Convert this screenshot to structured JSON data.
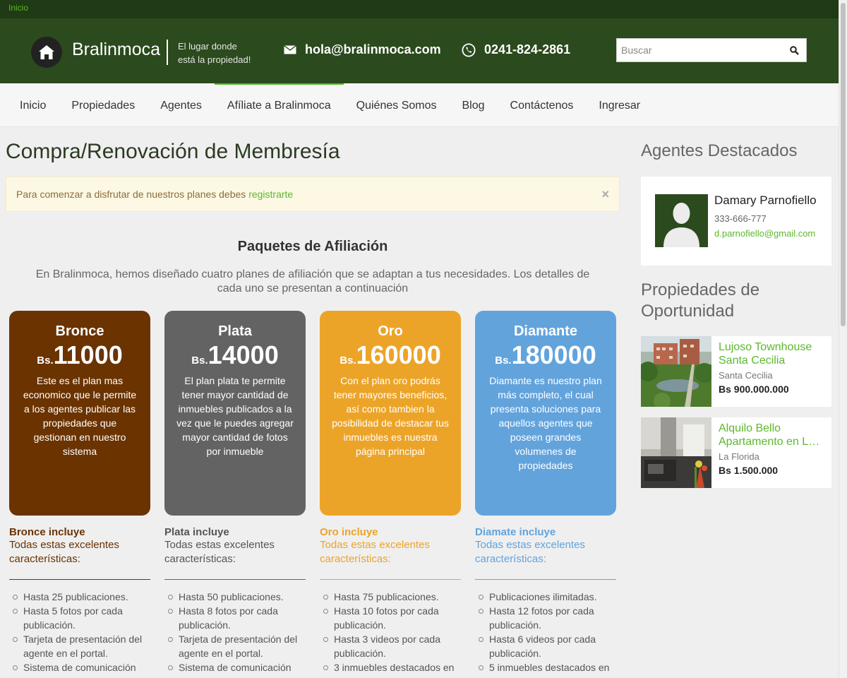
{
  "topbar": {
    "breadcrumb": "Inicio"
  },
  "header": {
    "brand": "Bralinmoca",
    "tagline_line1": "El lugar donde",
    "tagline_line2": "está la propiedad!",
    "email": "hola@bralinmoca.com",
    "phone": "0241-824-2861",
    "search_placeholder": "Buscar"
  },
  "nav": {
    "items": [
      "Inicio",
      "Propiedades",
      "Agentes",
      "Afíliate a Bralinmoca",
      "Quiénes Somos",
      "Blog",
      "Contáctenos",
      "Ingresar"
    ],
    "active": "Afíliate a Bralinmoca"
  },
  "main": {
    "title": "Compra/Renovación de Membresía",
    "alert_text": "Para comenzar a disfrutar de nuestros planes debes ",
    "alert_link": "registrarte",
    "alert_close": "×",
    "packages_title": "Paquetes de Afiliación",
    "packages_desc": "En Bralinmoca, hemos diseñado cuatro planes de afiliación que se adaptan a tus necesidades. Los detalles de cada uno se presentan a continuación"
  },
  "plans": [
    {
      "name": "Bronce",
      "currency": "Bs.",
      "price": "11000",
      "color": "#6b3300",
      "text_color": "#6b3300",
      "desc": "Este es el plan mas economico que le permite a los agentes publicar las propiedades que gestionan en nuestro sistema",
      "incl_title": "Bronce incluye",
      "incl_sub": "Todas estas excelentes características:",
      "features": [
        "Hasta 25 publicaciones.",
        "Hasta 5 fotos por cada publicación.",
        "Tarjeta de presentación del agente en el portal.",
        "Sistema de comunicación"
      ]
    },
    {
      "name": "Plata",
      "currency": "Bs.",
      "price": "14000",
      "color": "#636363",
      "text_color": "#555555",
      "desc": "El plan plata te permite tener mayor cantidad de inmuebles publicados a la vez que le puedes agregar mayor cantidad de fotos por inmueble",
      "incl_title": "Plata incluye",
      "incl_sub": "Todas estas excelentes características:",
      "features": [
        "Hasta 50 publicaciones.",
        "Hasta 8 fotos por cada publicación.",
        "Tarjeta de presentación del agente en el portal.",
        "Sistema de comunicación"
      ]
    },
    {
      "name": "Oro",
      "currency": "Bs.",
      "price": "160000",
      "color": "#eca428",
      "text_color": "#eca428",
      "desc": "Con el plan oro podrás tener mayores beneficios, así como tambien la posibilidad de destacar tus inmuebles es nuestra página principal",
      "incl_title": "Oro incluye",
      "incl_sub": "Todas estas excelentes características:",
      "features": [
        "Hasta 75 publicaciones.",
        "Hasta 10 fotos por cada publicación.",
        "Hasta 3 videos por cada publicación.",
        "3 inmuebles destacados en"
      ]
    },
    {
      "name": "Diamante",
      "currency": "Bs.",
      "price": "180000",
      "color": "#62a3dc",
      "text_color": "#62a3dc",
      "desc": "Diamante es nuestro plan más completo, el cual presenta soluciones para aquellos agentes que poseen grandes volumenes de propiedades",
      "incl_title": "Diamate incluye",
      "incl_sub": "Todas estas excelentes características:",
      "features": [
        "Publicaciones ilimitadas.",
        "Hasta 12 fotos por cada publicación.",
        "Hasta 6 videos por cada publicación.",
        "5 inmuebles destacados en"
      ]
    }
  ],
  "sidebar": {
    "agents_title": "Agentes Destacados",
    "agent": {
      "name": "Damary Parnofiello",
      "phone": "333-666-777",
      "email": "d.parnofiello@gmail.com"
    },
    "props_title": "Propiedades de Oportunidad",
    "properties": [
      {
        "title": "Lujoso Townhouse Santa Cecilia",
        "location": "Santa Cecilia",
        "price": "Bs 900.000.000"
      },
      {
        "title": "Alquilo Bello Apartamento en La Florida",
        "location": "La Florida",
        "price": "Bs 1.500.000"
      }
    ]
  },
  "colors": {
    "brand_dark": "#2b4a1d",
    "topbar": "#1f3a14",
    "accent_green": "#5cb82e"
  }
}
